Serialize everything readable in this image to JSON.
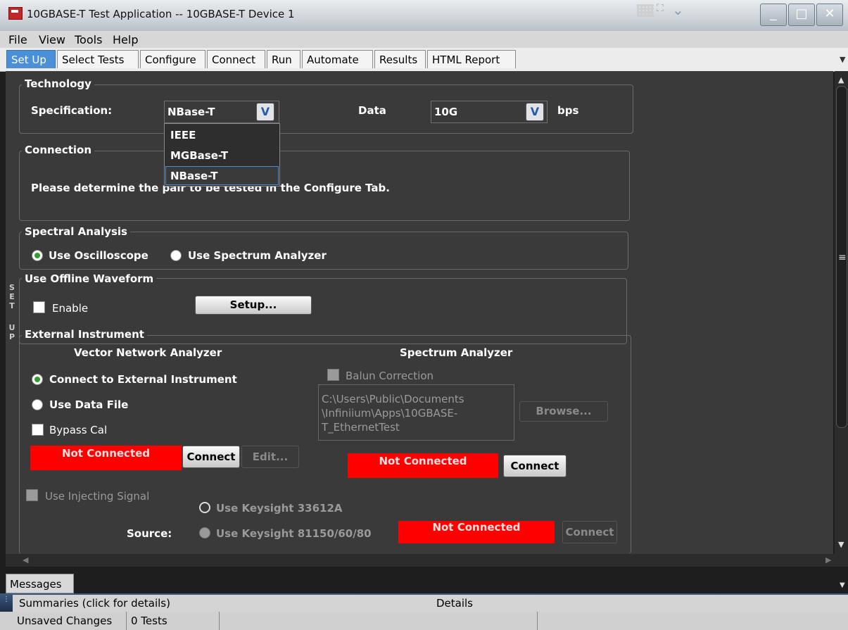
{
  "window": {
    "title": "10GBASE-T Test Application -- 10GBASE-T Device 1",
    "app_icon": "app-logo-icon",
    "controls": [
      "minimize-icon",
      "maximize-icon",
      "close-icon"
    ]
  },
  "menu": {
    "items": [
      "File",
      "View",
      "Tools",
      "Help"
    ]
  },
  "tabs": [
    {
      "label": "Set Up",
      "active": true
    },
    {
      "label": "Select Tests"
    },
    {
      "label": "Configure"
    },
    {
      "label": "Connect"
    },
    {
      "label": "Run"
    },
    {
      "label": "Automate"
    },
    {
      "label": "Results"
    },
    {
      "label": "HTML Report"
    }
  ],
  "sidebar_label": [
    "S",
    "E",
    "T",
    "",
    "U",
    "P"
  ],
  "technology": {
    "legend": "Technology",
    "spec_label": "Specification:",
    "spec_value": "NBase-T",
    "spec_options": [
      "IEEE",
      "MGBase-T",
      "NBase-T"
    ],
    "data_label": "Data",
    "data_value": "10G",
    "data_unit": "bps"
  },
  "connection": {
    "legend": "Connection",
    "message": "Please determine the pair to be tested in the Configure Tab."
  },
  "spectral": {
    "legend": "Spectral Analysis",
    "option_scope": "Use Oscilloscope",
    "option_spectrum": "Use Spectrum Analyzer",
    "selected": "Use Oscilloscope"
  },
  "offline": {
    "legend": "Use Offline Waveform",
    "enable_label": "Enable",
    "enable_checked": false,
    "setup_button": "Setup..."
  },
  "external": {
    "legend": "External Instrument",
    "vna": {
      "heading": "Vector Network Analyzer",
      "opt_connect": "Connect to External Instrument",
      "opt_datafile": "Use Data File",
      "bypass_label": "Bypass Cal",
      "status": "Not Connected",
      "connect_button": "Connect",
      "edit_button": "Edit..."
    },
    "sa": {
      "heading": "Spectrum Analyzer",
      "balun_label": "Balun Correction",
      "path_lines": [
        "C:\\Users\\Public\\Documents",
        "\\Infiniium\\Apps\\10GBASE-",
        "T_EthernetTest"
      ],
      "browse_button": "Browse...",
      "status": "Not Connected",
      "connect_button": "Connect"
    },
    "injecting": {
      "label": "Use Injecting Signal",
      "opt_33612a": "Use Keysight 33612A",
      "source_label": "Source:",
      "opt_81150": "Use Keysight 81150/60/80",
      "status": "Not Connected",
      "connect_button": "Connect"
    }
  },
  "bottom": {
    "messages_tab": "Messages",
    "summaries": "Summaries (click for details)",
    "details": "Details",
    "status_unsaved": "Unsaved Changes",
    "status_tests": "0 Tests"
  },
  "colors": {
    "accent": "#4a90d8",
    "status_red": "#ff0000",
    "panel": "#3a3a3a"
  }
}
